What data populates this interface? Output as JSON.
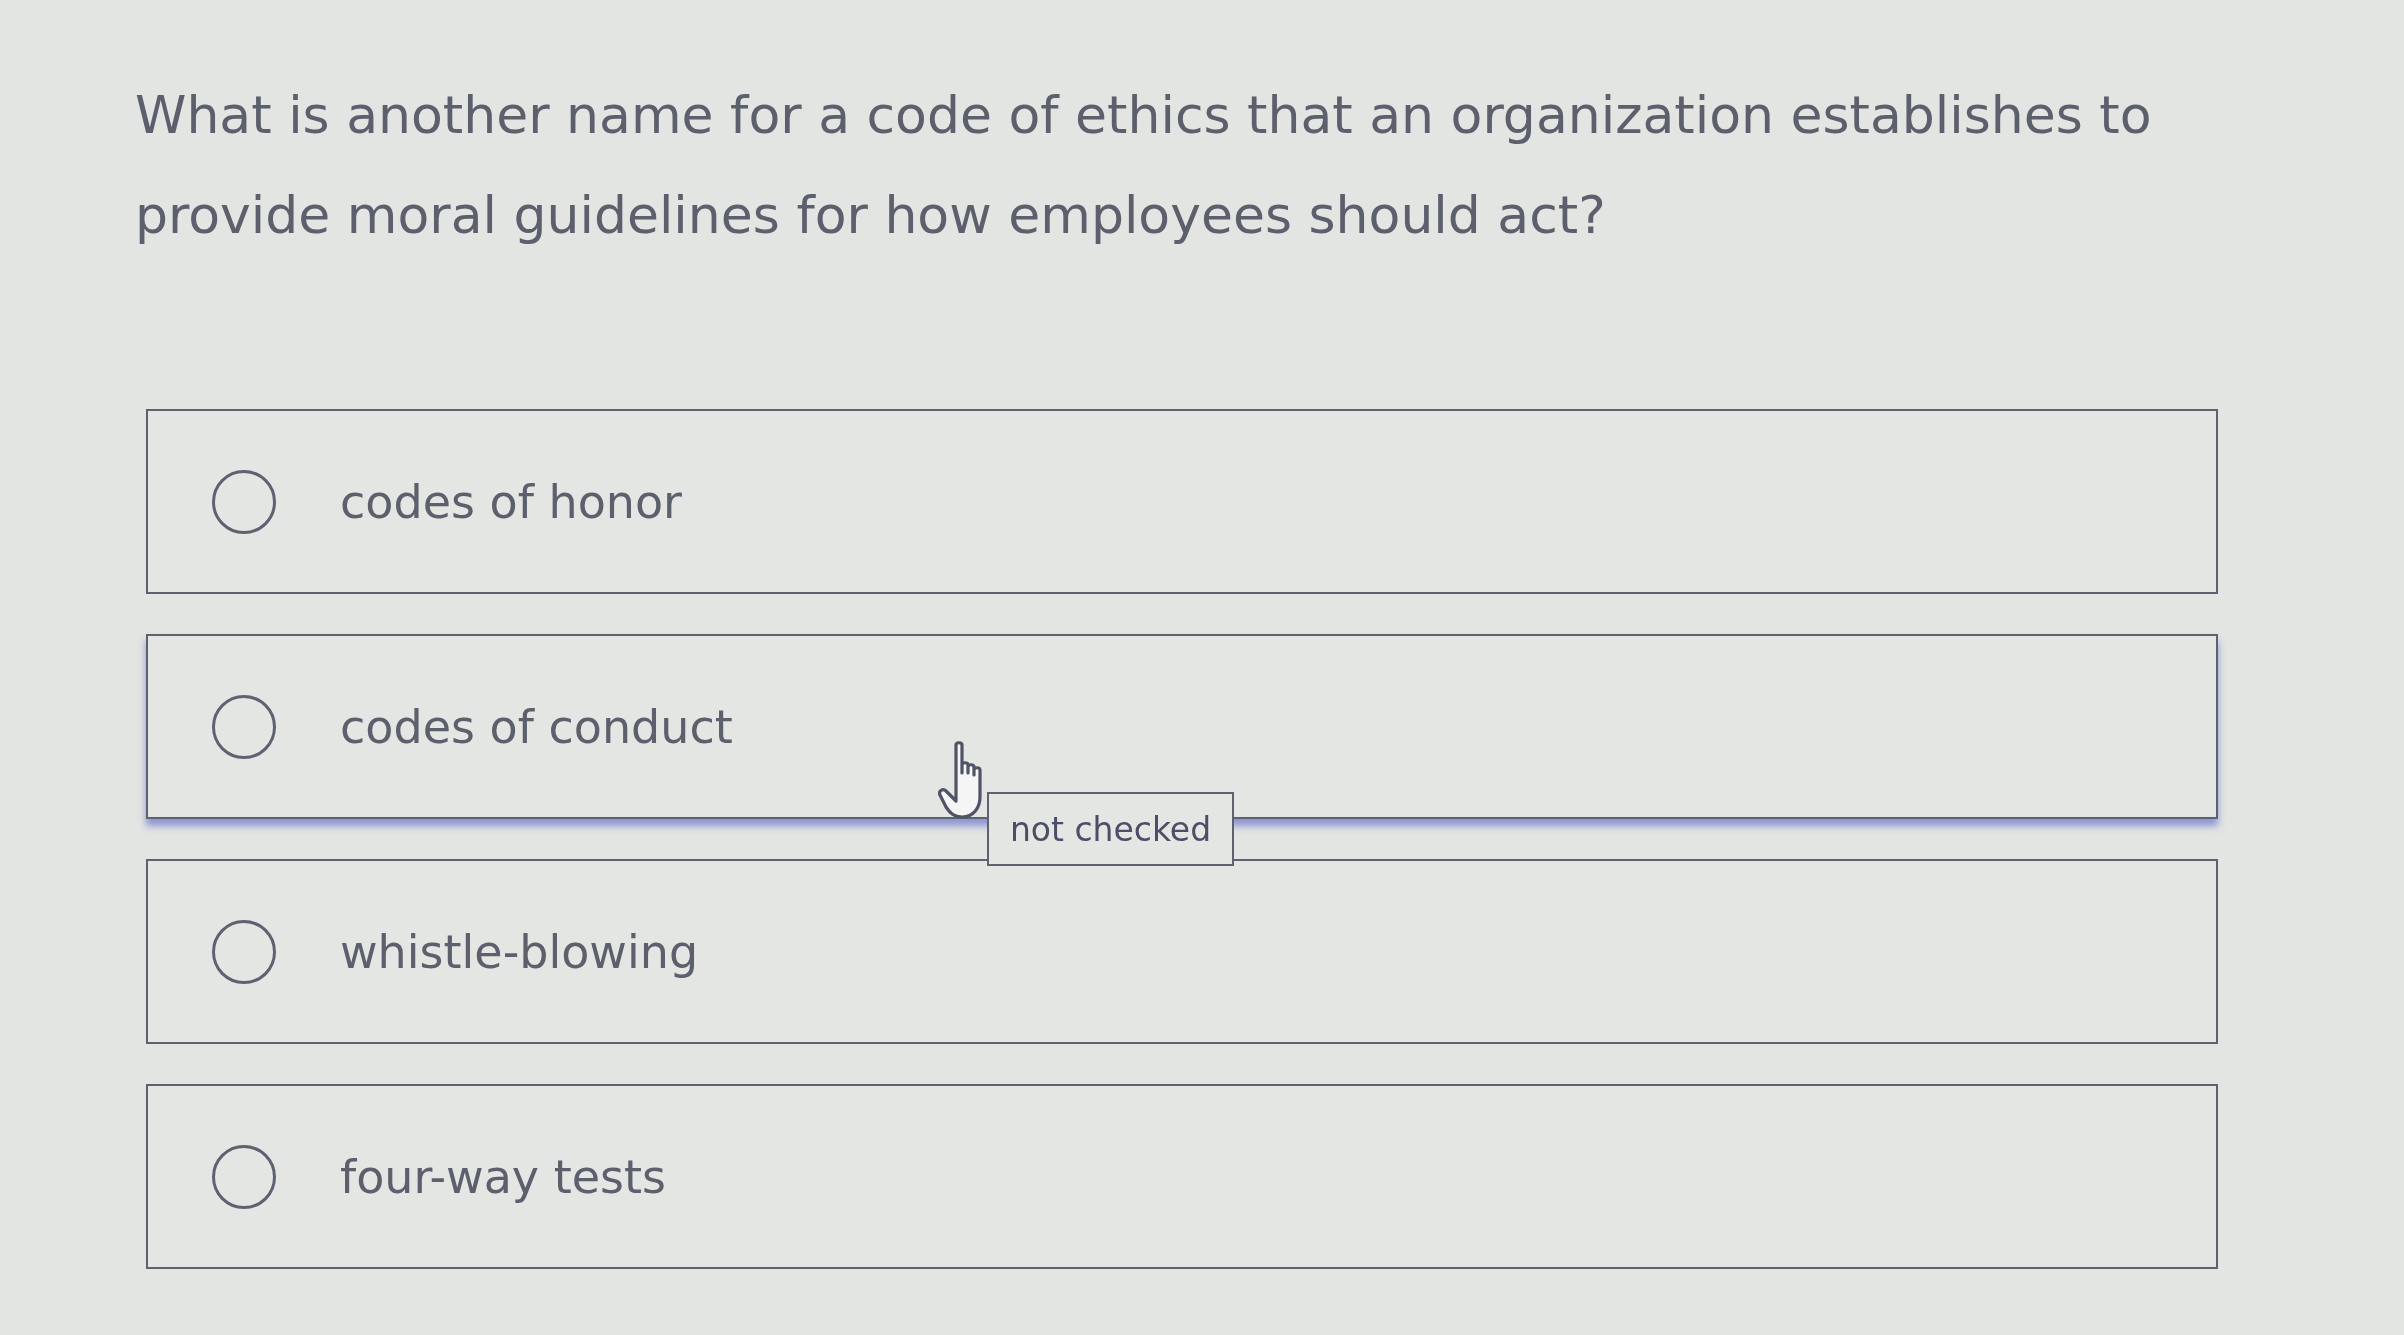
{
  "question": "What is another name for a code of ethics that an organization establishes to provide moral guidelines for how employees should act?",
  "options": [
    {
      "label": "codes of honor",
      "selected": false,
      "hovered": false
    },
    {
      "label": "codes of conduct",
      "selected": false,
      "hovered": true
    },
    {
      "label": "whistle-blowing",
      "selected": false,
      "hovered": false
    },
    {
      "label": "four-way tests",
      "selected": false,
      "hovered": false
    }
  ],
  "tooltip": "not checked"
}
